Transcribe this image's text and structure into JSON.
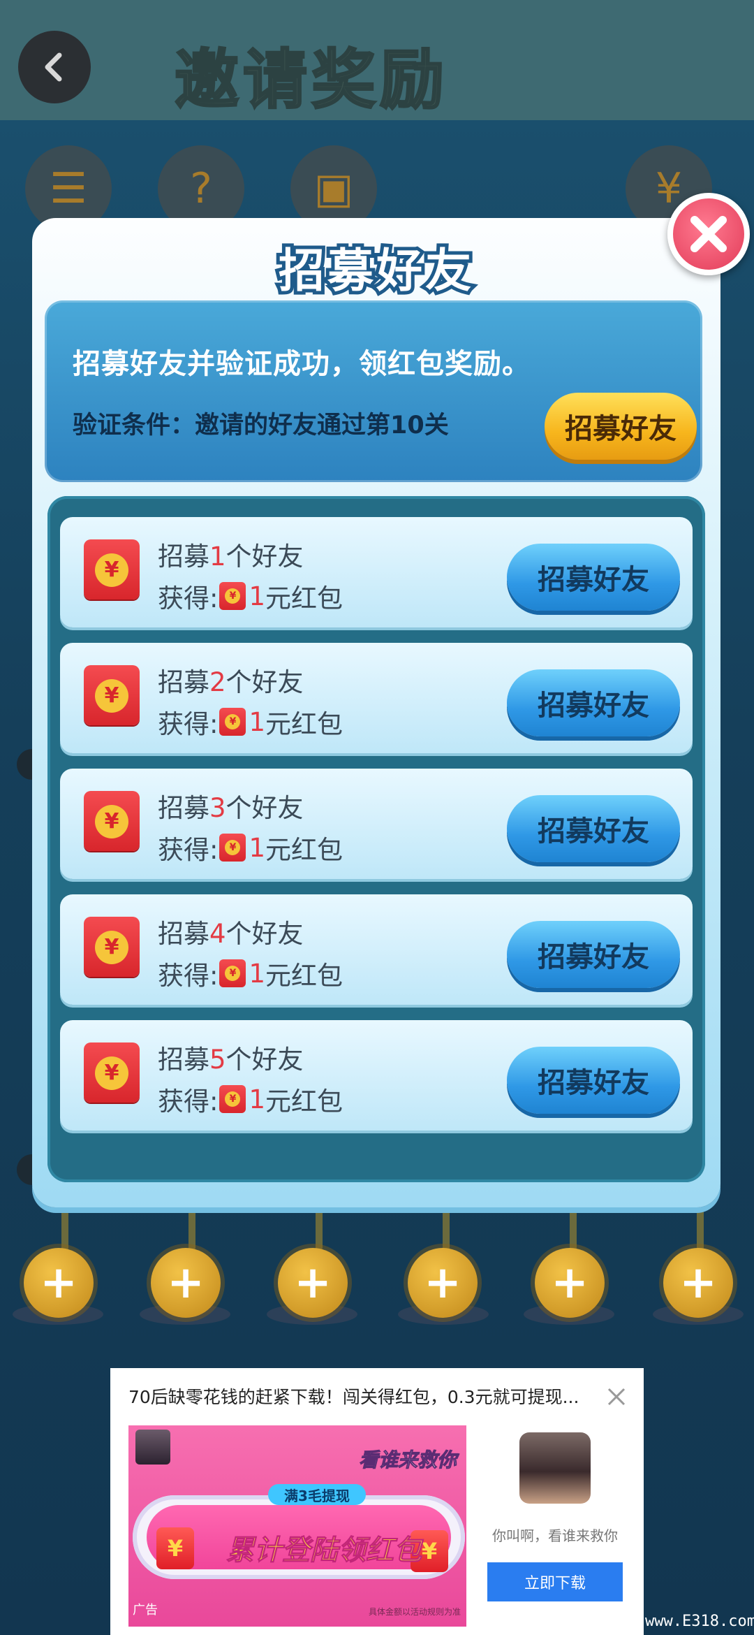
{
  "background": {
    "title": "邀请奖励"
  },
  "modal": {
    "title": "招募好友",
    "info": {
      "line1": "招募好友并验证成功，领红包奖励。",
      "line2": "验证条件：邀请的好友通过第10关",
      "button": "招募好友"
    },
    "rows": [
      {
        "prefix": "招募",
        "count": "1",
        "suffix": "个好友",
        "reward_prefix": "获得:",
        "amount": "1",
        "reward_suffix": "元红包",
        "button": "招募好友"
      },
      {
        "prefix": "招募",
        "count": "2",
        "suffix": "个好友",
        "reward_prefix": "获得:",
        "amount": "1",
        "reward_suffix": "元红包",
        "button": "招募好友"
      },
      {
        "prefix": "招募",
        "count": "3",
        "suffix": "个好友",
        "reward_prefix": "获得:",
        "amount": "1",
        "reward_suffix": "元红包",
        "button": "招募好友"
      },
      {
        "prefix": "招募",
        "count": "4",
        "suffix": "个好友",
        "reward_prefix": "获得:",
        "amount": "1",
        "reward_suffix": "元红包",
        "button": "招募好友"
      },
      {
        "prefix": "招募",
        "count": "5",
        "suffix": "个好友",
        "reward_prefix": "获得:",
        "amount": "1",
        "reward_suffix": "元红包",
        "button": "招募好友"
      }
    ],
    "envelope_symbol": "¥"
  },
  "ad": {
    "headline": "70后缺零花钱的赶紧下载！闯关得红包，0.3元就可提现...",
    "tag": "满3毛提现",
    "main_text": "累计登陆领红包",
    "logo_text": "看谁来救你",
    "label": "广告",
    "fine_print": "具体金额以活动规则为准",
    "app_description": "你叫啊，看谁来救你",
    "download_button": "立即下载"
  },
  "watermark": "www.E318.com",
  "colors": {
    "modal_title_stroke": "#1f5b8b",
    "accent_red": "#e33b44",
    "gold_button": "#f7b51c",
    "blue_button": "#2f98e6",
    "ad_download": "#2a7df0"
  },
  "icons": [
    "back-arrow-icon",
    "close-icon",
    "red-envelope-icon",
    "coin-plus-icon",
    "ad-close-icon"
  ]
}
